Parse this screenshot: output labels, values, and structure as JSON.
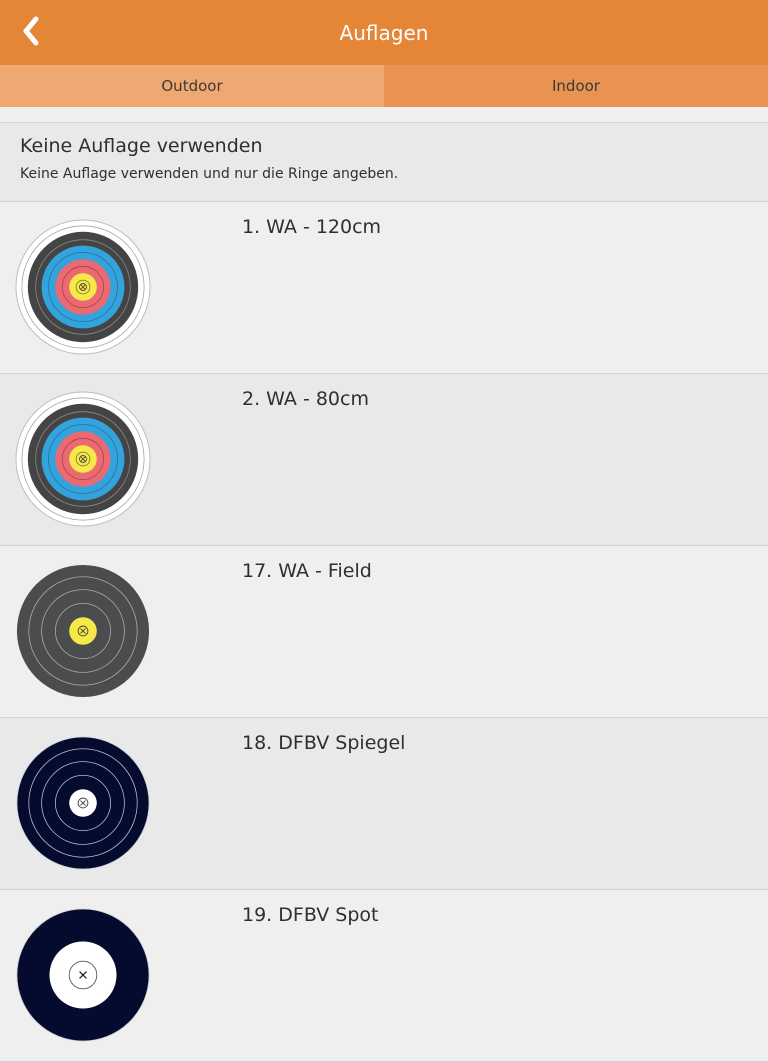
{
  "header": {
    "title": "Auflagen",
    "back_icon": "chevron-left-icon"
  },
  "tabs": [
    {
      "label": "Outdoor",
      "active": true
    },
    {
      "label": "Indoor",
      "active": false
    }
  ],
  "none_option": {
    "title": "Keine Auflage verwenden",
    "description": "Keine Auflage verwenden und nur die Ringe angeben."
  },
  "targets": [
    {
      "label": "1. WA - 120cm",
      "icon": "wa-full-target-icon"
    },
    {
      "label": "2. WA - 80cm",
      "icon": "wa-full-target-icon"
    },
    {
      "label": "17. WA - Field",
      "icon": "wa-field-target-icon"
    },
    {
      "label": "18. DFBV Spiegel",
      "icon": "dfbv-spiegel-target-icon"
    },
    {
      "label": "19. DFBV Spot",
      "icon": "dfbv-spot-target-icon"
    }
  ],
  "colors": {
    "header": "#e58536",
    "tab_active": "#f0a872",
    "tab_inactive": "#e99352",
    "gold": "#f7e84a",
    "red": "#ea6a72",
    "blue": "#33a3dd",
    "black_ring": "#444444",
    "field_dark": "#4a4c4d",
    "dfbv_navy": "#050b2e"
  }
}
